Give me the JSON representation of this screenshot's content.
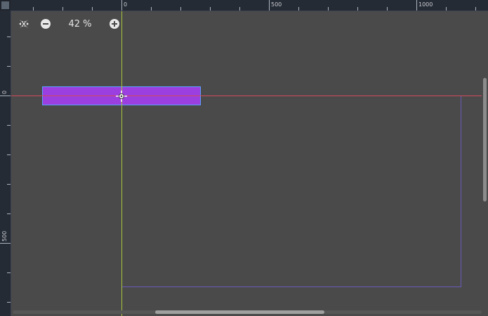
{
  "viewport": {
    "zoom_level": "42 %",
    "background_color": "#4a4a4a"
  },
  "rulers": {
    "horizontal_labels": [
      "0",
      "500",
      "1000"
    ],
    "vertical_labels": [
      "0",
      "500"
    ],
    "background_color": "#252b34"
  },
  "toolbar": {
    "zoom_reset_icon": "center-view-icon",
    "zoom_out_icon": "zoom-out-icon",
    "zoom_in_icon": "zoom-in-icon"
  },
  "scene": {
    "selected_node_color": "#9b3fe0",
    "selected_node_border_color": "#5aa0ff",
    "origin_axis_x_color": "#d04a5c",
    "origin_axis_y_color": "#a8c43a",
    "viewport_frame_color": "#6a5ab8",
    "pivot_icon": "pivot-crosshair-icon"
  }
}
